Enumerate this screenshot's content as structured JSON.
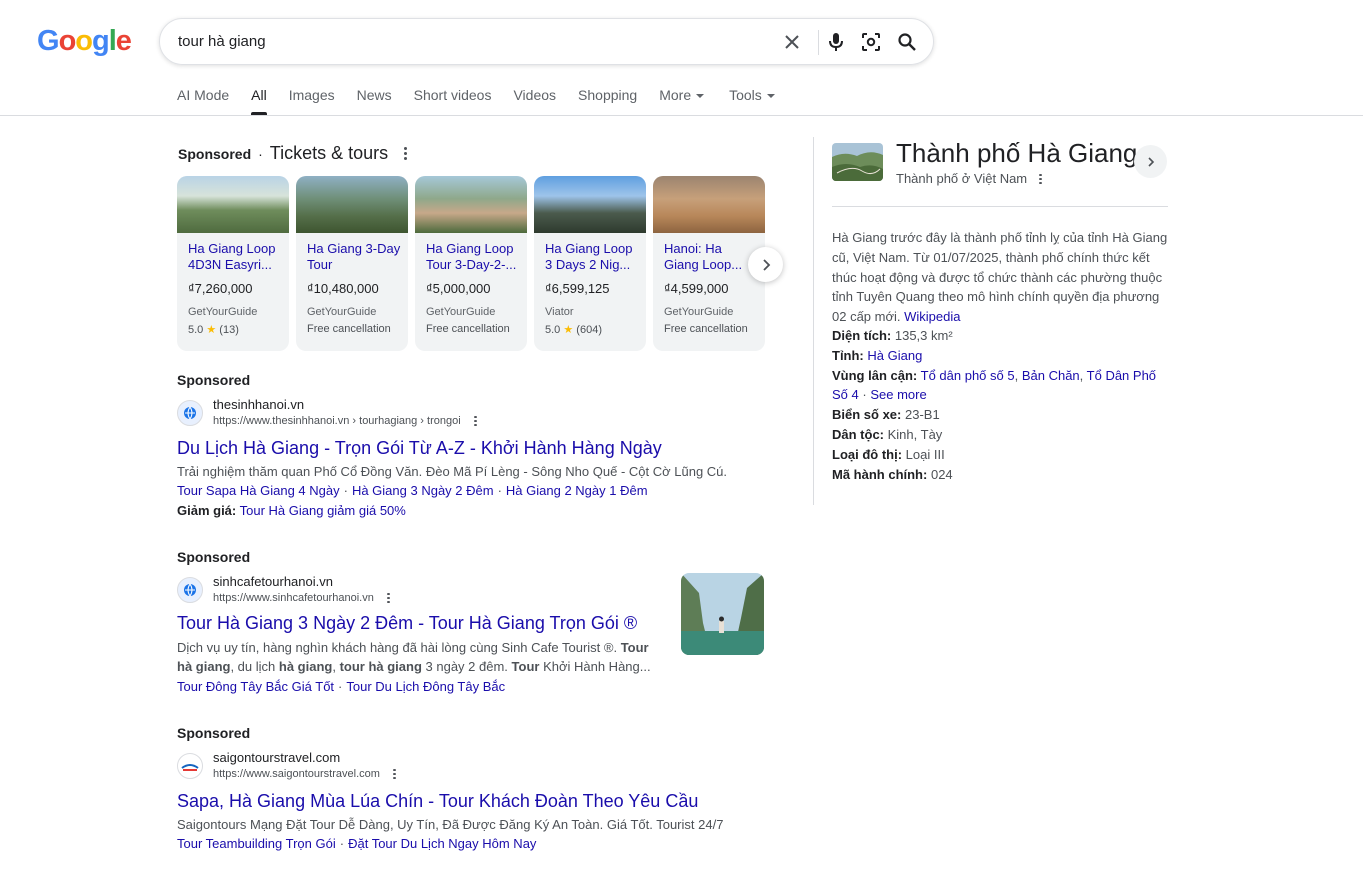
{
  "logo": {
    "letters": [
      "G",
      "o",
      "o",
      "g",
      "l",
      "e"
    ],
    "colors": [
      "#4285f4",
      "#ea4335",
      "#fbbc05",
      "#4285f4",
      "#34a853",
      "#ea4335"
    ]
  },
  "search": {
    "query": "tour hà giang"
  },
  "icons": {
    "clear": "close-icon",
    "mic": "mic-icon",
    "lens": "lens-icon",
    "search": "search-icon"
  },
  "tabs": [
    {
      "label": "AI Mode"
    },
    {
      "label": "All"
    },
    {
      "label": "Images"
    },
    {
      "label": "News"
    },
    {
      "label": "Short videos"
    },
    {
      "label": "Videos"
    },
    {
      "label": "Shopping"
    },
    {
      "label": "More"
    },
    {
      "label": "Tools"
    }
  ],
  "tickets": {
    "sponsored": "Sponsored",
    "dot": "·",
    "title": "Tickets & tours",
    "cards": [
      {
        "title": "Ha Giang Loop 4D3N Easyri...",
        "price": "₫7,260,000",
        "seller": "GetYourGuide",
        "rating": "5.0",
        "star": "★",
        "reviews": "(13)"
      },
      {
        "title": "Ha Giang 3-Day Tour",
        "price": "₫10,480,000",
        "seller": "GetYourGuide",
        "extra": "Free cancellation"
      },
      {
        "title": "Ha Giang Loop Tour 3-Day-2-...",
        "price": "₫5,000,000",
        "seller": "GetYourGuide",
        "extra": "Free cancellation"
      },
      {
        "title": "Ha Giang Loop 3 Days 2 Nig...",
        "price": "₫6,599,125",
        "seller": "Viator",
        "rating": "5.0",
        "star": "★",
        "reviews": "(604)"
      },
      {
        "title": "Hanoi: Ha Giang Loop...",
        "price": "₫4,599,000",
        "seller": "GetYourGuide",
        "extra": "Free cancellation"
      }
    ]
  },
  "ads": [
    {
      "sponsored": "Sponsored",
      "site_name": "thesinhhanoi.vn",
      "site_url": "https://www.thesinhhanoi.vn › tourhagiang › trongoi",
      "title": "Du Lịch Hà Giang - Trọn Gói Từ A-Z - Khởi Hành Hàng Ngày",
      "desc": "Trải nghiệm thăm quan Phố Cổ Đồng Văn. Đèo Mã Pí Lèng - Sông Nho Quế - Cột Cờ Lũng Cú.",
      "links": [
        "Tour Sapa Hà Giang 4 Ngày",
        "Hà Giang 3 Ngày 2 Đêm",
        "Hà Giang 2 Ngày 1 Đêm"
      ],
      "promo_label": "Giảm giá:",
      "promo_link": "Tour Hà Giang giảm giá 50%"
    },
    {
      "sponsored": "Sponsored",
      "site_name": "sinhcafetourhanoi.vn",
      "site_url": "https://www.sinhcafetourhanoi.vn",
      "title": "Tour Hà Giang 3 Ngày 2 Đêm - Tour Hà Giang Trọn Gói ®",
      "desc_parts": [
        {
          "t": "Dịch vụ uy tín, hàng nghìn khách hàng đã hài lòng cùng Sinh Cafe Tourist ®. ",
          "b": false
        },
        {
          "t": "Tour hà giang",
          "b": true
        },
        {
          "t": ", du lịch ",
          "b": false
        },
        {
          "t": "hà giang",
          "b": true
        },
        {
          "t": ", ",
          "b": false
        },
        {
          "t": "tour hà giang",
          "b": true
        },
        {
          "t": " 3 ngày 2 đêm. ",
          "b": false
        },
        {
          "t": "Tour",
          "b": true
        },
        {
          "t": " Khởi Hành Hàng...",
          "b": false
        }
      ],
      "links": [
        "Tour Đông Tây Bắc Giá Tốt",
        "Tour Du Lịch Đông Tây Bắc"
      ]
    },
    {
      "sponsored": "Sponsored",
      "site_name": "saigontourstravel.com",
      "site_url": "https://www.saigontourstravel.com",
      "title": "Sapa, Hà Giang Mùa Lúa Chín - Tour Khách Đoàn Theo Yêu Cầu",
      "desc": "Saigontours Mạng Đặt Tour Dễ Dàng, Uy Tín, Đã Được Đăng Ký An Toàn. Giá Tốt. Tourist 24/7",
      "links": [
        "Tour Teambuilding Trọn Gói",
        "Đặt Tour Du Lịch Ngay Hôm Nay"
      ]
    }
  ],
  "link_sep": "·",
  "knowledge": {
    "title": "Thành phố Hà Giang",
    "subtitle": "Thành phố ở Việt Nam",
    "desc": "Hà Giang trước đây là thành phố tỉnh lỵ của tỉnh Hà Giang cũ, Việt Nam. Từ 01/07/2025, thành phố chính thức kết thúc hoạt động và được tổ chức thành các phường thuộc tỉnh Tuyên Quang theo mô hình chính quyền địa phương 02 cấp mới.",
    "source": "Wikipedia",
    "facts": {
      "area_label": "Diện tích:",
      "area_value": "135,3 km²",
      "province_label": "Tỉnh:",
      "province_value": "Hà Giang",
      "nearby_label": "Vùng lân cận:",
      "nearby_1": "Tổ dân phố số 5",
      "nearby_2": "Bản Chăn",
      "nearby_3": "Tổ Dân Phố Số 4",
      "see_more": "See more",
      "plate_label": "Biển số xe:",
      "plate_value": "23-B1",
      "ethnic_label": "Dân tộc:",
      "ethnic_value": "Kinh, Tày",
      "urban_label": "Loại đô thị:",
      "urban_value": "Loại III",
      "admin_label": "Mã hành chính:",
      "admin_value": "024"
    }
  }
}
